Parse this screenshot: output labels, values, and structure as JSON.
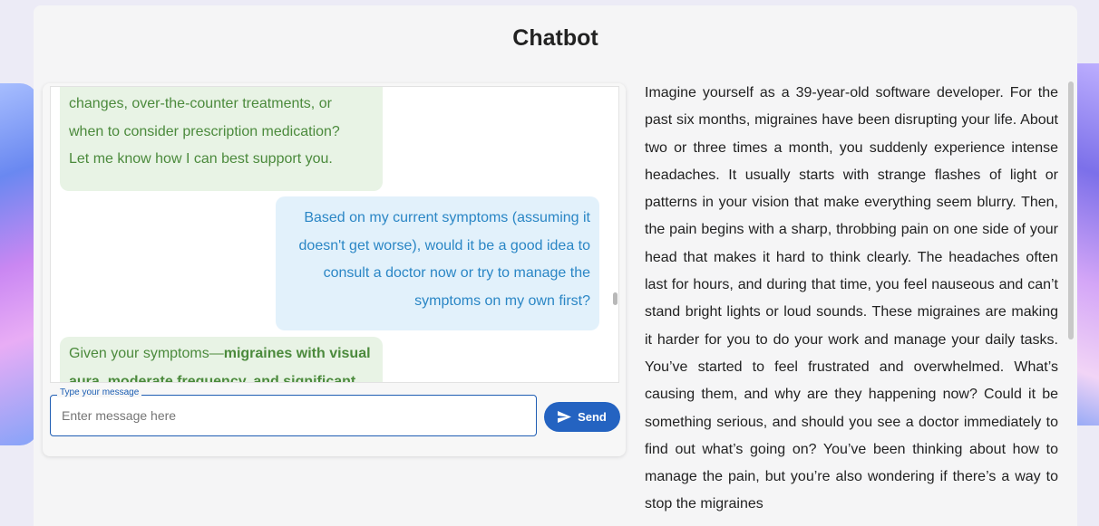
{
  "header": {
    "title": "Chatbot"
  },
  "messages": [
    {
      "role": "bot",
      "lines": [
        "changes, over-the-counter treatments, or",
        "when to consider prescription medication?",
        "Let me know how I can best support you."
      ]
    },
    {
      "role": "user",
      "lines": [
        "Based on my current symptoms (assuming it",
        "doesn't get worse), would it be a good idea to",
        "consult a doctor now or try to manage the",
        "symptoms on my own first?"
      ]
    },
    {
      "role": "bot",
      "prefix": "Given your symptoms—",
      "bold1": "migraines with visual",
      "line2": "aura, moderate frequency, and significant"
    }
  ],
  "input": {
    "legend": "Type your message",
    "placeholder": "Enter message here",
    "value": ""
  },
  "send_button": {
    "label": "Send"
  },
  "scenario": {
    "text": "Imagine yourself as a 39-year-old software developer. For the past six months, migraines have been disrupting your life. About two or three times a month, you suddenly experience intense headaches. It usually starts with strange flashes of light or patterns in your vision that make everything seem blurry. Then, the pain begins with a sharp, throbbing pain on one side of your head that makes it hard to think clearly. The headaches often last for hours, and during that time, you feel nauseous and can’t stand bright lights or loud sounds. These migraines are making it harder for you to do your work and manage your daily tasks. You’ve started to feel frustrated and overwhelmed. What’s causing them, and why are they happening now? Could it be something serious, and should you see a doctor immediately to find out what’s going on? You’ve been thinking about how to manage the pain, but you’re also wondering if there’s a way to stop the migraines"
  },
  "colors": {
    "accent": "#2463c1",
    "bot_text": "#4b8a3c",
    "user_text": "#2a86c5"
  }
}
